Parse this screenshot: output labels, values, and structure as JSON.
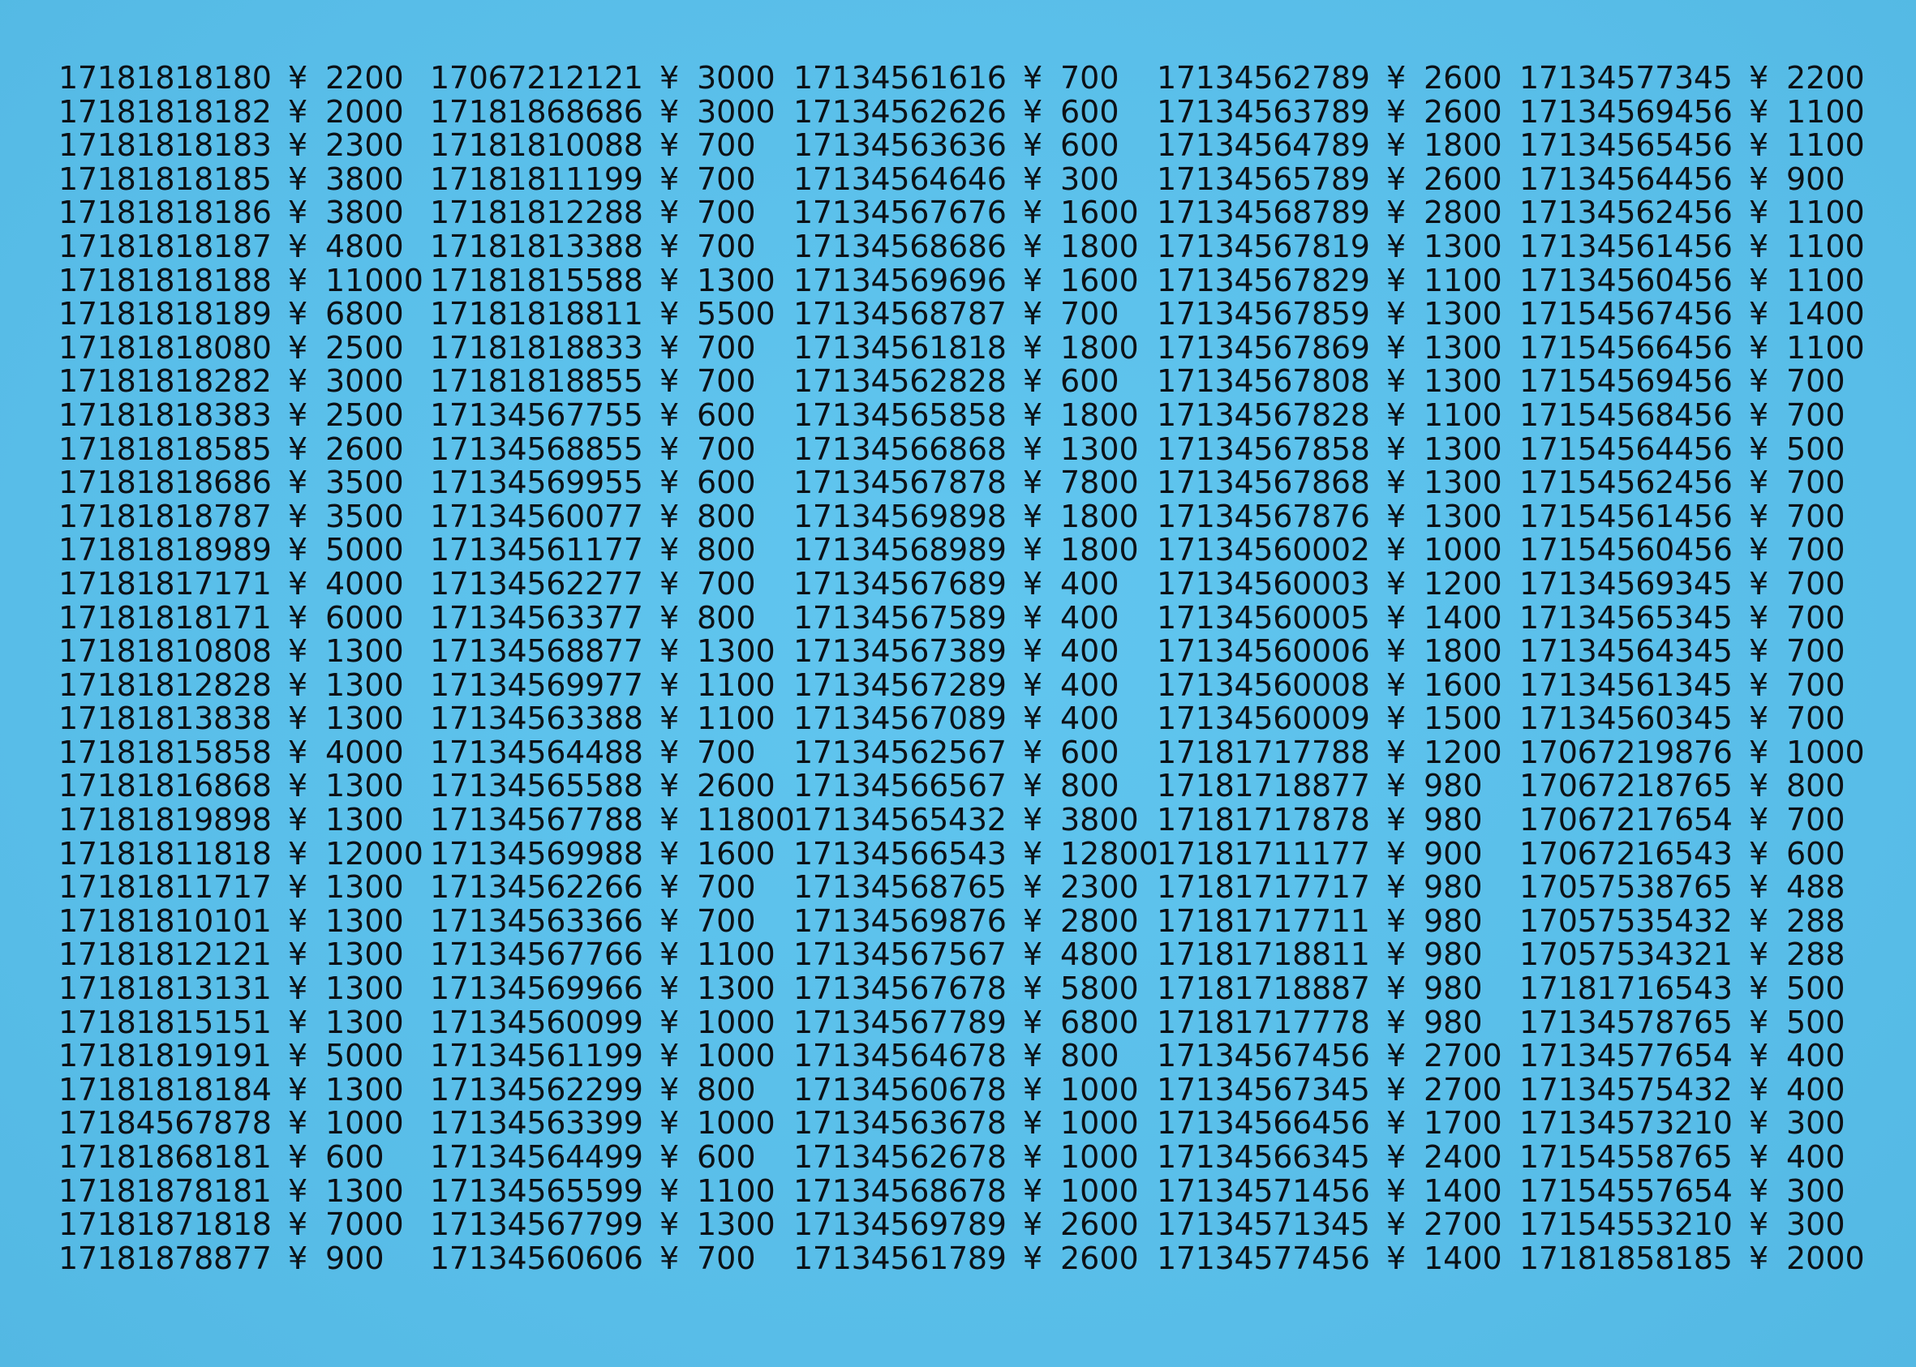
{
  "currency_symbol": "¥",
  "columns": [
    {
      "rows": [
        {
          "number": "17181818180",
          "price": "2200"
        },
        {
          "number": "17181818182",
          "price": "2000"
        },
        {
          "number": "17181818183",
          "price": "2300"
        },
        {
          "number": "17181818185",
          "price": "3800"
        },
        {
          "number": "17181818186",
          "price": "3800"
        },
        {
          "number": "17181818187",
          "price": "4800"
        },
        {
          "number": "17181818188",
          "price": "11000"
        },
        {
          "number": "17181818189",
          "price": "6800"
        },
        {
          "number": "17181818080",
          "price": "2500"
        },
        {
          "number": "17181818282",
          "price": "3000"
        },
        {
          "number": "17181818383",
          "price": "2500"
        },
        {
          "number": "17181818585",
          "price": "2600"
        },
        {
          "number": "17181818686",
          "price": "3500"
        },
        {
          "number": "17181818787",
          "price": "3500"
        },
        {
          "number": "17181818989",
          "price": "5000"
        },
        {
          "number": "17181817171",
          "price": "4000"
        },
        {
          "number": "17181818171",
          "price": "6000"
        },
        {
          "number": "17181810808",
          "price": "1300"
        },
        {
          "number": "17181812828",
          "price": "1300"
        },
        {
          "number": "17181813838",
          "price": "1300"
        },
        {
          "number": "17181815858",
          "price": "4000"
        },
        {
          "number": "17181816868",
          "price": "1300"
        },
        {
          "number": "17181819898",
          "price": "1300"
        },
        {
          "number": "17181811818",
          "price": "12000"
        },
        {
          "number": "17181811717",
          "price": "1300"
        },
        {
          "number": "17181810101",
          "price": "1300"
        },
        {
          "number": "17181812121",
          "price": "1300"
        },
        {
          "number": "17181813131",
          "price": "1300"
        },
        {
          "number": "17181815151",
          "price": "1300"
        },
        {
          "number": "17181819191",
          "price": "5000"
        },
        {
          "number": "17181818184",
          "price": "1300"
        },
        {
          "number": "17184567878",
          "price": "1000"
        },
        {
          "number": "17181868181",
          "price": "600"
        },
        {
          "number": "17181878181",
          "price": "1300"
        },
        {
          "number": "17181871818",
          "price": "7000"
        },
        {
          "number": "17181878877",
          "price": "900"
        }
      ]
    },
    {
      "rows": [
        {
          "number": "17067212121",
          "price": "3000"
        },
        {
          "number": "17181868686",
          "price": "3000"
        },
        {
          "number": "17181810088",
          "price": "700"
        },
        {
          "number": "17181811199",
          "price": "700"
        },
        {
          "number": "17181812288",
          "price": "700"
        },
        {
          "number": "17181813388",
          "price": "700"
        },
        {
          "number": "17181815588",
          "price": "1300"
        },
        {
          "number": "17181818811",
          "price": "5500"
        },
        {
          "number": "17181818833",
          "price": "700"
        },
        {
          "number": "17181818855",
          "price": "700"
        },
        {
          "number": "17134567755",
          "price": "600"
        },
        {
          "number": "17134568855",
          "price": "700"
        },
        {
          "number": "17134569955",
          "price": "600"
        },
        {
          "number": "17134560077",
          "price": "800"
        },
        {
          "number": "17134561177",
          "price": "800"
        },
        {
          "number": "17134562277",
          "price": "700"
        },
        {
          "number": "17134563377",
          "price": "800"
        },
        {
          "number": "17134568877",
          "price": "1300"
        },
        {
          "number": "17134569977",
          "price": "1100"
        },
        {
          "number": "17134563388",
          "price": "1100"
        },
        {
          "number": "17134564488",
          "price": "700"
        },
        {
          "number": "17134565588",
          "price": "2600"
        },
        {
          "number": "17134567788",
          "price": "11800"
        },
        {
          "number": "17134569988",
          "price": "1600"
        },
        {
          "number": "17134562266",
          "price": "700"
        },
        {
          "number": "17134563366",
          "price": "700"
        },
        {
          "number": "17134567766",
          "price": "1100"
        },
        {
          "number": "17134569966",
          "price": "1300"
        },
        {
          "number": "17134560099",
          "price": "1000"
        },
        {
          "number": "17134561199",
          "price": "1000"
        },
        {
          "number": "17134562299",
          "price": "800"
        },
        {
          "number": "17134563399",
          "price": "1000"
        },
        {
          "number": "17134564499",
          "price": "600"
        },
        {
          "number": "17134565599",
          "price": "1100"
        },
        {
          "number": "17134567799",
          "price": "1300"
        },
        {
          "number": "17134560606",
          "price": "700"
        }
      ]
    },
    {
      "rows": [
        {
          "number": "17134561616",
          "price": "700"
        },
        {
          "number": "17134562626",
          "price": "600"
        },
        {
          "number": "17134563636",
          "price": "600"
        },
        {
          "number": "17134564646",
          "price": "300"
        },
        {
          "number": "17134567676",
          "price": "1600"
        },
        {
          "number": "17134568686",
          "price": "1800"
        },
        {
          "number": "17134569696",
          "price": "1600"
        },
        {
          "number": "17134568787",
          "price": "700"
        },
        {
          "number": "17134561818",
          "price": "1800"
        },
        {
          "number": "17134562828",
          "price": "600"
        },
        {
          "number": "17134565858",
          "price": "1800"
        },
        {
          "number": "17134566868",
          "price": "1300"
        },
        {
          "number": "17134567878",
          "price": "7800"
        },
        {
          "number": "17134569898",
          "price": "1800"
        },
        {
          "number": "17134568989",
          "price": "1800"
        },
        {
          "number": "17134567689",
          "price": "400"
        },
        {
          "number": "17134567589",
          "price": "400"
        },
        {
          "number": "17134567389",
          "price": "400"
        },
        {
          "number": "17134567289",
          "price": "400"
        },
        {
          "number": "17134567089",
          "price": "400"
        },
        {
          "number": "17134562567",
          "price": "600"
        },
        {
          "number": "17134566567",
          "price": "800"
        },
        {
          "number": "17134565432",
          "price": "3800"
        },
        {
          "number": "17134566543",
          "price": "12800"
        },
        {
          "number": "17134568765",
          "price": "2300"
        },
        {
          "number": "17134569876",
          "price": "2800"
        },
        {
          "number": "17134567567",
          "price": "4800"
        },
        {
          "number": "17134567678",
          "price": "5800"
        },
        {
          "number": "17134567789",
          "price": "6800"
        },
        {
          "number": "17134564678",
          "price": "800"
        },
        {
          "number": "17134560678",
          "price": "1000"
        },
        {
          "number": "17134563678",
          "price": "1000"
        },
        {
          "number": "17134562678",
          "price": "1000"
        },
        {
          "number": "17134568678",
          "price": "1000"
        },
        {
          "number": "17134569789",
          "price": "2600"
        },
        {
          "number": "17134561789",
          "price": "2600"
        }
      ]
    },
    {
      "rows": [
        {
          "number": "17134562789",
          "price": "2600"
        },
        {
          "number": "17134563789",
          "price": "2600"
        },
        {
          "number": "17134564789",
          "price": "1800"
        },
        {
          "number": "17134565789",
          "price": "2600"
        },
        {
          "number": "17134568789",
          "price": "2800"
        },
        {
          "number": "17134567819",
          "price": "1300"
        },
        {
          "number": "17134567829",
          "price": "1100"
        },
        {
          "number": "17134567859",
          "price": "1300"
        },
        {
          "number": "17134567869",
          "price": "1300"
        },
        {
          "number": "17134567808",
          "price": "1300"
        },
        {
          "number": "17134567828",
          "price": "1100"
        },
        {
          "number": "17134567858",
          "price": "1300"
        },
        {
          "number": "17134567868",
          "price": "1300"
        },
        {
          "number": "17134567876",
          "price": "1300"
        },
        {
          "number": "17134560002",
          "price": "1000"
        },
        {
          "number": "17134560003",
          "price": "1200"
        },
        {
          "number": "17134560005",
          "price": "1400"
        },
        {
          "number": "17134560006",
          "price": "1800"
        },
        {
          "number": "17134560008",
          "price": "1600"
        },
        {
          "number": "17134560009",
          "price": "1500"
        },
        {
          "number": "17181717788",
          "price": "1200"
        },
        {
          "number": "17181718877",
          "price": "980"
        },
        {
          "number": "17181717878",
          "price": "980"
        },
        {
          "number": "17181711177",
          "price": "900"
        },
        {
          "number": "17181717717",
          "price": "980"
        },
        {
          "number": "17181717711",
          "price": "980"
        },
        {
          "number": "17181718811",
          "price": "980"
        },
        {
          "number": "17181718887",
          "price": "980"
        },
        {
          "number": "17181717778",
          "price": "980"
        },
        {
          "number": "17134567456",
          "price": "2700"
        },
        {
          "number": "17134567345",
          "price": "2700"
        },
        {
          "number": "17134566456",
          "price": "1700"
        },
        {
          "number": "17134566345",
          "price": "2400"
        },
        {
          "number": "17134571456",
          "price": "1400"
        },
        {
          "number": "17134571345",
          "price": "2700"
        },
        {
          "number": "17134577456",
          "price": "1400"
        }
      ]
    },
    {
      "rows": [
        {
          "number": "17134577345",
          "price": "2200"
        },
        {
          "number": "17134569456",
          "price": "1100"
        },
        {
          "number": "17134565456",
          "price": "1100"
        },
        {
          "number": "17134564456",
          "price": "900"
        },
        {
          "number": "17134562456",
          "price": "1100"
        },
        {
          "number": "17134561456",
          "price": "1100"
        },
        {
          "number": "17134560456",
          "price": "1100"
        },
        {
          "number": "17154567456",
          "price": "1400"
        },
        {
          "number": "17154566456",
          "price": "1100"
        },
        {
          "number": "17154569456",
          "price": "700"
        },
        {
          "number": "17154568456",
          "price": "700"
        },
        {
          "number": "17154564456",
          "price": "500"
        },
        {
          "number": "17154562456",
          "price": "700"
        },
        {
          "number": "17154561456",
          "price": "700"
        },
        {
          "number": "17154560456",
          "price": "700"
        },
        {
          "number": "17134569345",
          "price": "700"
        },
        {
          "number": "17134565345",
          "price": "700"
        },
        {
          "number": "17134564345",
          "price": "700"
        },
        {
          "number": "17134561345",
          "price": "700"
        },
        {
          "number": "17134560345",
          "price": "700"
        },
        {
          "number": "17067219876",
          "price": "1000"
        },
        {
          "number": "17067218765",
          "price": "800"
        },
        {
          "number": "17067217654",
          "price": "700"
        },
        {
          "number": "17067216543",
          "price": "600"
        },
        {
          "number": "17057538765",
          "price": "488"
        },
        {
          "number": "17057535432",
          "price": "288"
        },
        {
          "number": "17057534321",
          "price": "288"
        },
        {
          "number": "17181716543",
          "price": "500"
        },
        {
          "number": "17134578765",
          "price": "500"
        },
        {
          "number": "17134577654",
          "price": "400"
        },
        {
          "number": "17134575432",
          "price": "400"
        },
        {
          "number": "17134573210",
          "price": "300"
        },
        {
          "number": "17154558765",
          "price": "400"
        },
        {
          "number": "17154557654",
          "price": "300"
        },
        {
          "number": "17154553210",
          "price": "300"
        },
        {
          "number": "17181858185",
          "price": "2000"
        }
      ]
    }
  ]
}
